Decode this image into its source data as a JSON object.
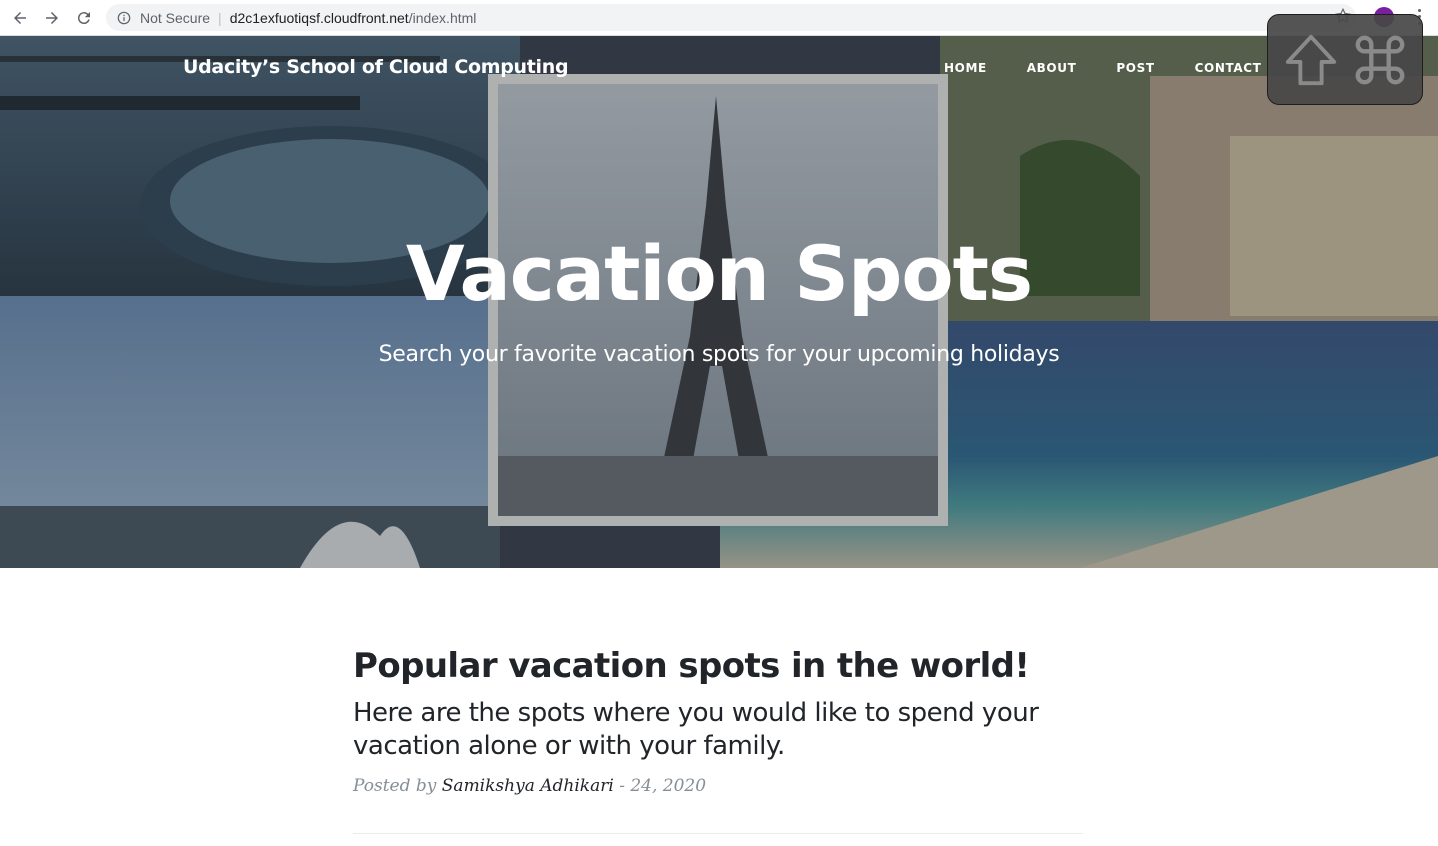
{
  "browser": {
    "security_label": "Not Secure",
    "url_host": "d2c1exfuotiqsf.cloudfront.net",
    "url_path": "/index.html"
  },
  "site": {
    "brand": "Udacity’s School of Cloud Computing",
    "nav": [
      {
        "label": "HOME"
      },
      {
        "label": "ABOUT"
      },
      {
        "label": "POST"
      },
      {
        "label": "CONTACT"
      }
    ]
  },
  "hero": {
    "title": "Vacation Spots",
    "subtitle": "Search your favorite vacation spots for your upcoming holidays"
  },
  "post": {
    "title": "Popular vacation spots in the world!",
    "subtitle": "Here are the spots where you would like to spend your vacation alone or with your family.",
    "posted_by_label": "Posted by",
    "author": "Samikshya Adhikari",
    "date": "- 24, 2020"
  },
  "key_overlay": {
    "icons": [
      "shift-icon",
      "command-icon"
    ]
  }
}
